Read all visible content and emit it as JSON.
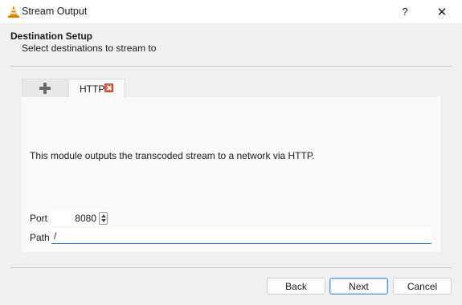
{
  "window": {
    "title": "Stream Output",
    "help_symbol": "?",
    "close_symbol": "✕",
    "app_icon": "vlc-cone-icon"
  },
  "header": {
    "title": "Destination Setup",
    "subtitle": "Select destinations to stream to"
  },
  "tabs": [
    {
      "icon": "plus-icon"
    },
    {
      "label": "HTTP",
      "close_icon": "close-tab-icon"
    }
  ],
  "panel": {
    "description": "This module outputs the transcoded stream to a network via HTTP.",
    "port_label": "Port",
    "port_value": "8080",
    "path_label": "Path",
    "path_value": "/"
  },
  "buttons": {
    "back": "Back",
    "next": "Next",
    "cancel": "Cancel"
  },
  "colors": {
    "accent": "#2a6fd6",
    "tab_close": "#d9604a",
    "vlc_orange": "#f28a00"
  }
}
